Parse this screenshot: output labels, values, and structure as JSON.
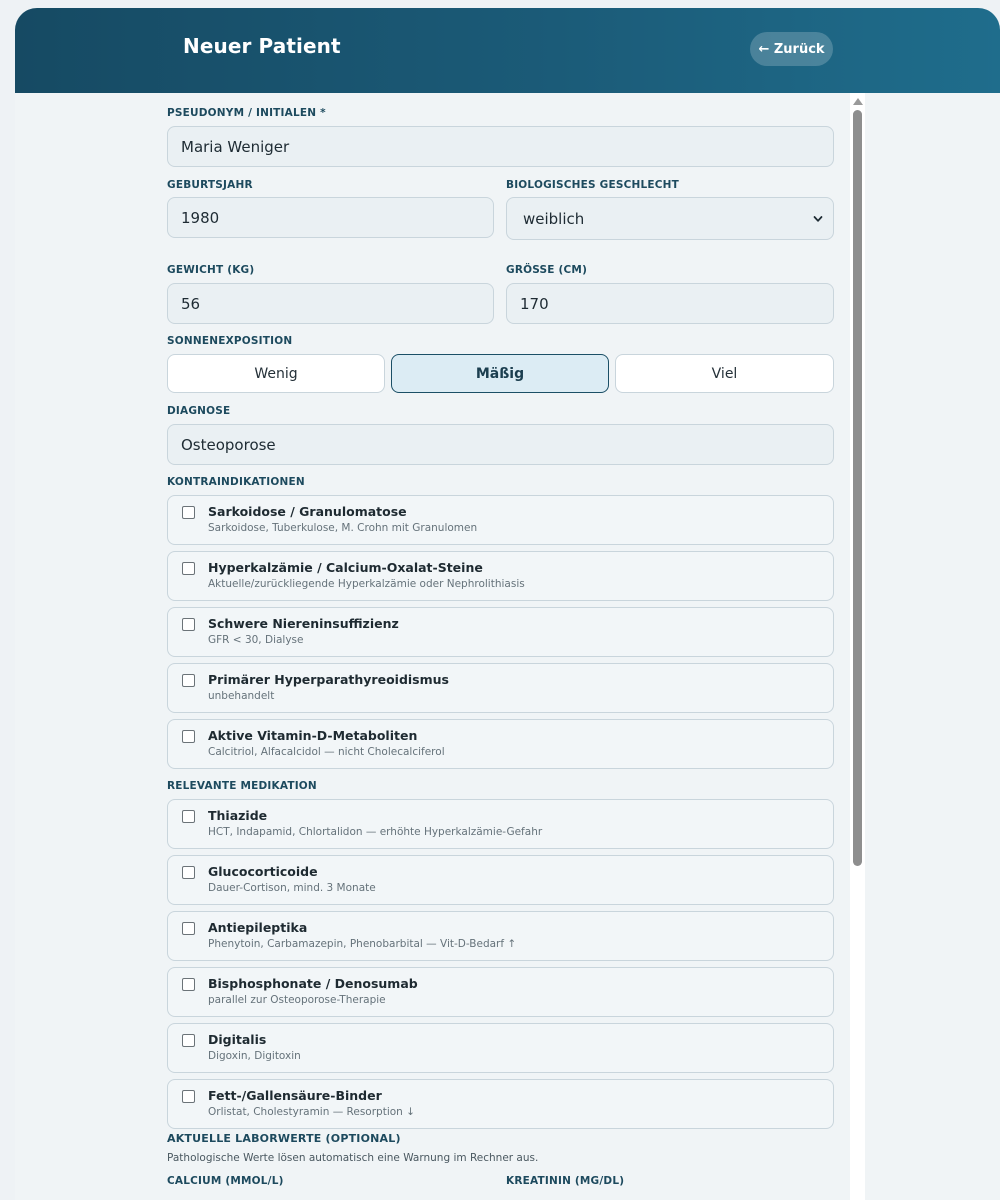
{
  "header": {
    "title": "Neuer Patient",
    "back_label": "← Zurück"
  },
  "form": {
    "pseudonym": {
      "label": "Pseudonym / Initialen *",
      "value": "Maria Weniger"
    },
    "birth_year": {
      "label": "Geburtsjahr",
      "value": "1980"
    },
    "sex": {
      "label": "Biologisches Geschlecht",
      "value": "weiblich"
    },
    "weight": {
      "label": "Gewicht (kg)",
      "value": "56"
    },
    "height": {
      "label": "Grösse (cm)",
      "value": "170"
    },
    "sun": {
      "label": "Sonnenexposition",
      "options": [
        "Wenig",
        "Mäßig",
        "Viel"
      ],
      "selected": "Mäßig"
    },
    "diagnosis": {
      "label": "Diagnose",
      "value": "Osteoporose"
    },
    "contraindications": {
      "label": "Kontraindikationen",
      "items": [
        {
          "title": "Sarkoidose / Granulomatose",
          "desc": "Sarkoidose, Tuberkulose, M. Crohn mit Granulomen",
          "checked": false
        },
        {
          "title": "Hyperkalzämie / Calcium-Oxalat-Steine",
          "desc": "Aktuelle/zurückliegende Hyperkalzämie oder Nephrolithiasis",
          "checked": false
        },
        {
          "title": "Schwere Niereninsuffizienz",
          "desc": "GFR < 30, Dialyse",
          "checked": false
        },
        {
          "title": "Primärer Hyperparathyreoidismus",
          "desc": "unbehandelt",
          "checked": false
        },
        {
          "title": "Aktive Vitamin-D-Metaboliten",
          "desc": "Calcitriol, Alfacalcidol — nicht Cholecalciferol",
          "checked": false
        }
      ]
    },
    "medication": {
      "label": "Relevante Medikation",
      "items": [
        {
          "title": "Thiazide",
          "desc": "HCT, Indapamid, Chlortalidon — erhöhte Hyperkalzämie-Gefahr",
          "checked": false
        },
        {
          "title": "Glucocorticoide",
          "desc": "Dauer-Cortison, mind. 3 Monate",
          "checked": false
        },
        {
          "title": "Antiepileptika",
          "desc": "Phenytoin, Carbamazepin, Phenobarbital — Vit-D-Bedarf ↑",
          "checked": false
        },
        {
          "title": "Bisphosphonate / Denosumab",
          "desc": "parallel zur Osteoporose-Therapie",
          "checked": false
        },
        {
          "title": "Digitalis",
          "desc": "Digoxin, Digitoxin",
          "checked": false
        },
        {
          "title": "Fett-/Gallensäure-Binder",
          "desc": "Orlistat, Cholestyramin — Resorption ↓",
          "checked": false
        }
      ]
    },
    "labs": {
      "label": "Aktuelle Laborwerte (optional)",
      "note": "Pathologische Werte lösen automatisch eine Warnung im Rechner aus.",
      "calcium_label": "Calcium (mmol/L)",
      "creatinine_label": "Kreatinin (mg/dL)"
    }
  }
}
